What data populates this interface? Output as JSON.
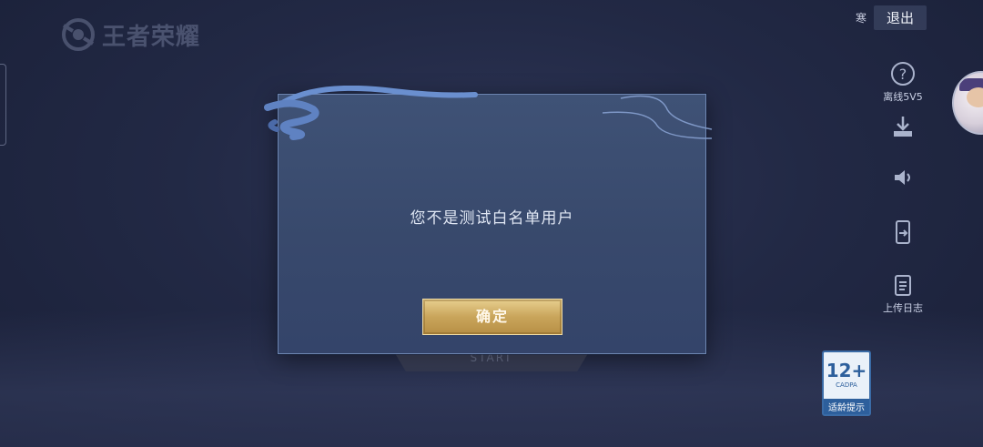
{
  "brand": {
    "logo_text": "王者荣耀"
  },
  "top_bar": {
    "small_label": "寒",
    "exit_label": "退出"
  },
  "side_panel": {
    "items": [
      {
        "icon": "help-icon",
        "label": "离线5V5"
      },
      {
        "icon": "download-icon",
        "label": ""
      },
      {
        "icon": "speaker-icon",
        "label": ""
      },
      {
        "icon": "phone-swap-icon",
        "label": ""
      },
      {
        "icon": "clipboard-icon",
        "label": "上传日志"
      }
    ]
  },
  "start_plate": {
    "label": "START"
  },
  "age_rating": {
    "number": "12+",
    "org": "CADPA",
    "caption": "适龄提示"
  },
  "dialog": {
    "message": "您不是测试白名单用户",
    "confirm_label": "确定"
  },
  "colors": {
    "dialog_bg": "#3b4c70",
    "confirm_gold": "#c9a55b",
    "border_accent": "#6e86b2"
  }
}
